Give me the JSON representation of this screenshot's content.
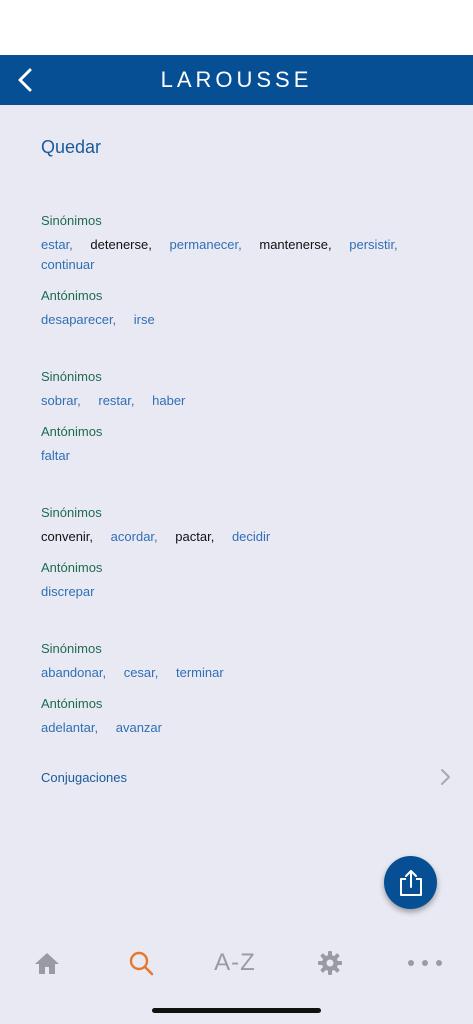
{
  "header": {
    "title": "LAROUSSE"
  },
  "entry": {
    "title": "Quedar"
  },
  "groups": [
    {
      "syn_label": "Sinónimos",
      "syn": [
        "estar,",
        "detenerse,",
        "permanecer,",
        "mantenerse,",
        "persistir,",
        "continuar"
      ],
      "ant_label": "Antónimos",
      "ant": [
        "desaparecer,",
        "irse"
      ]
    },
    {
      "syn_label": "Sinónimos",
      "syn": [
        "sobrar,",
        "restar,",
        "haber"
      ],
      "ant_label": "Antónimos",
      "ant": [
        "faltar"
      ]
    },
    {
      "syn_label": "Sinónimos",
      "syn": [
        "convenir,",
        "acordar,",
        "pactar,",
        "decidir"
      ],
      "ant_label": "Antónimos",
      "ant": [
        "discrepar"
      ]
    },
    {
      "syn_label": "Sinónimos",
      "syn": [
        "abandonar,",
        "cesar,",
        "terminar"
      ],
      "ant_label": "Antónimos",
      "ant": [
        "adelantar,",
        "avanzar"
      ]
    }
  ],
  "conjugations": {
    "label": "Conjugaciones"
  },
  "tabs": {
    "az_label": "A-Z"
  },
  "icons": {
    "back": "chevron-left-icon",
    "share": "share-icon",
    "home": "home-icon",
    "search": "search-icon",
    "settings": "gear-icon",
    "more": "more-icon",
    "chevron": "chevron-right-icon"
  },
  "colors": {
    "brand": "#074f95",
    "link": "#2f6fb6",
    "label": "#1f6b4f",
    "active_tab": "#e8772e",
    "inactive_tab": "#9a9aa3"
  }
}
